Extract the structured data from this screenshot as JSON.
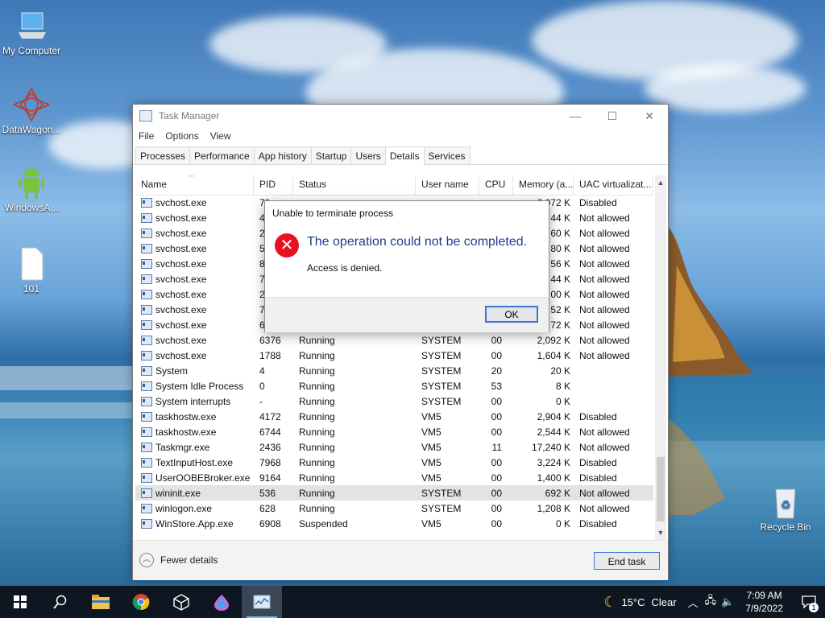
{
  "desktop": {
    "icons": [
      {
        "label": "My Computer",
        "icon": "computer-icon"
      },
      {
        "label": "DataWagon...",
        "icon": "datawagon-icon"
      },
      {
        "label": "WindowsA...",
        "icon": "android-icon"
      },
      {
        "label": "101",
        "icon": "file-icon"
      },
      {
        "label": "Recycle Bin",
        "icon": "recycle-bin-icon"
      }
    ]
  },
  "task_manager": {
    "title": "Task Manager",
    "menu": [
      "File",
      "Options",
      "View"
    ],
    "tabs": [
      "Processes",
      "Performance",
      "App history",
      "Startup",
      "Users",
      "Details",
      "Services"
    ],
    "active_tab": "Details",
    "columns": [
      "Name",
      "PID",
      "Status",
      "User name",
      "CPU",
      "Memory (a...",
      "UAC virtualizat..."
    ],
    "rows": [
      {
        "name": "svchost.exe",
        "pid": "78",
        "status": "",
        "user": "",
        "cpu": "",
        "mem": "2,072 K",
        "uac": "Disabled"
      },
      {
        "name": "svchost.exe",
        "pid": "49",
        "status": "",
        "user": "",
        "cpu": "",
        "mem": "44 K",
        "uac": "Not allowed"
      },
      {
        "name": "svchost.exe",
        "pid": "24",
        "status": "",
        "user": "",
        "cpu": "",
        "mem": "60 K",
        "uac": "Not allowed"
      },
      {
        "name": "svchost.exe",
        "pid": "53",
        "status": "",
        "user": "",
        "cpu": "",
        "mem": "80 K",
        "uac": "Not allowed"
      },
      {
        "name": "svchost.exe",
        "pid": "84",
        "status": "",
        "user": "",
        "cpu": "",
        "mem": "56 K",
        "uac": "Not allowed"
      },
      {
        "name": "svchost.exe",
        "pid": "71",
        "status": "",
        "user": "",
        "cpu": "",
        "mem": "44 K",
        "uac": "Not allowed"
      },
      {
        "name": "svchost.exe",
        "pid": "27",
        "status": "",
        "user": "",
        "cpu": "",
        "mem": "00 K",
        "uac": "Not allowed"
      },
      {
        "name": "svchost.exe",
        "pid": "76",
        "status": "",
        "user": "",
        "cpu": "",
        "mem": "52 K",
        "uac": "Not allowed"
      },
      {
        "name": "svchost.exe",
        "pid": "64",
        "status": "",
        "user": "",
        "cpu": "",
        "mem": "72 K",
        "uac": "Not allowed"
      },
      {
        "name": "svchost.exe",
        "pid": "6376",
        "status": "Running",
        "user": "SYSTEM",
        "cpu": "00",
        "mem": "2,092 K",
        "uac": "Not allowed"
      },
      {
        "name": "svchost.exe",
        "pid": "1788",
        "status": "Running",
        "user": "SYSTEM",
        "cpu": "00",
        "mem": "1,604 K",
        "uac": "Not allowed"
      },
      {
        "name": "System",
        "pid": "4",
        "status": "Running",
        "user": "SYSTEM",
        "cpu": "20",
        "mem": "20 K",
        "uac": ""
      },
      {
        "name": "System Idle Process",
        "pid": "0",
        "status": "Running",
        "user": "SYSTEM",
        "cpu": "53",
        "mem": "8 K",
        "uac": ""
      },
      {
        "name": "System interrupts",
        "pid": "-",
        "status": "Running",
        "user": "SYSTEM",
        "cpu": "00",
        "mem": "0 K",
        "uac": ""
      },
      {
        "name": "taskhostw.exe",
        "pid": "4172",
        "status": "Running",
        "user": "VM5",
        "cpu": "00",
        "mem": "2,904 K",
        "uac": "Disabled"
      },
      {
        "name": "taskhostw.exe",
        "pid": "6744",
        "status": "Running",
        "user": "VM5",
        "cpu": "00",
        "mem": "2,544 K",
        "uac": "Not allowed"
      },
      {
        "name": "Taskmgr.exe",
        "pid": "2436",
        "status": "Running",
        "user": "VM5",
        "cpu": "11",
        "mem": "17,240 K",
        "uac": "Not allowed"
      },
      {
        "name": "TextInputHost.exe",
        "pid": "7968",
        "status": "Running",
        "user": "VM5",
        "cpu": "00",
        "mem": "3,224 K",
        "uac": "Disabled"
      },
      {
        "name": "UserOOBEBroker.exe",
        "pid": "9164",
        "status": "Running",
        "user": "VM5",
        "cpu": "00",
        "mem": "1,400 K",
        "uac": "Disabled"
      },
      {
        "name": "wininit.exe",
        "pid": "536",
        "status": "Running",
        "user": "SYSTEM",
        "cpu": "00",
        "mem": "692 K",
        "uac": "Not allowed",
        "selected": true
      },
      {
        "name": "winlogon.exe",
        "pid": "628",
        "status": "Running",
        "user": "SYSTEM",
        "cpu": "00",
        "mem": "1,208 K",
        "uac": "Not allowed"
      },
      {
        "name": "WinStore.App.exe",
        "pid": "6908",
        "status": "Suspended",
        "user": "VM5",
        "cpu": "00",
        "mem": "0 K",
        "uac": "Disabled"
      }
    ],
    "fewer_details_label": "Fewer details",
    "end_task_label": "End task"
  },
  "dialog": {
    "title": "Unable to terminate process",
    "main_instruction": "The operation could not be completed.",
    "content": "Access is denied.",
    "ok_label": "OK"
  },
  "taskbar": {
    "weather_temp": "15°C",
    "weather_text": "Clear",
    "time": "7:09 AM",
    "date": "7/9/2022",
    "notification_count": "1"
  }
}
